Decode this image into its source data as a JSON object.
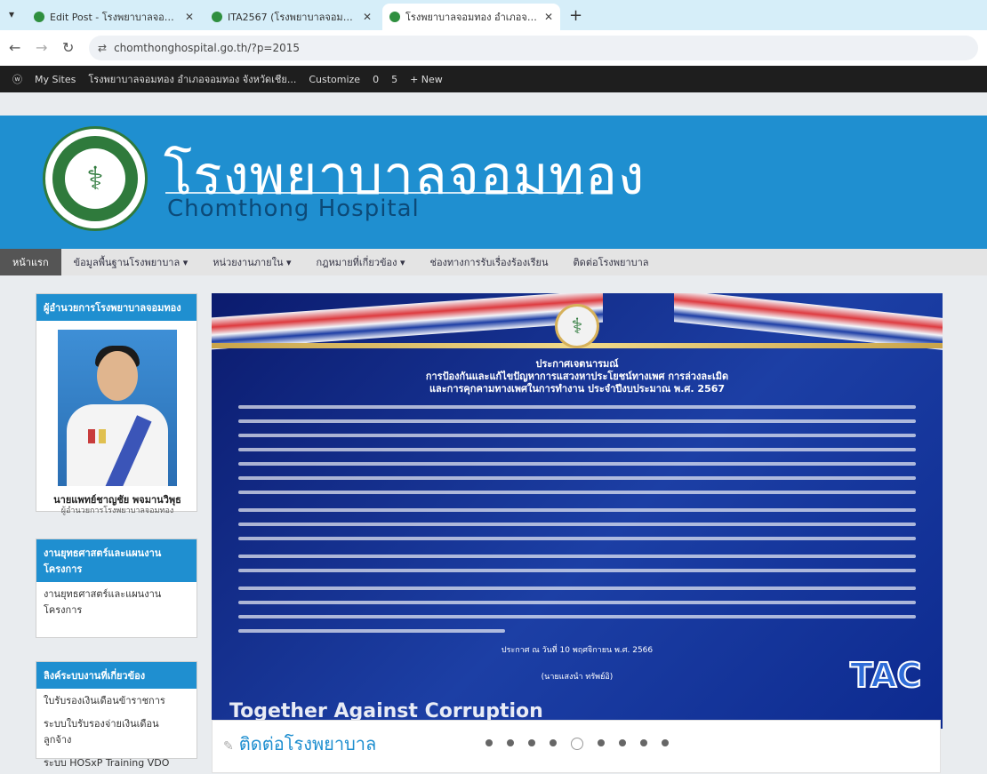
{
  "browser": {
    "tabs": [
      {
        "title": "Edit Post - โรงพยาบาลจอมทอง อำ...",
        "active": false
      },
      {
        "title": "ITA2567 (โรงพยาบาลจอมทอง อำ...",
        "active": false
      },
      {
        "title": "โรงพยาบาลจอมทอง อำเภอจอมทอง...",
        "active": true
      }
    ],
    "url": "chomthonghospital.go.th/?p=2015",
    "site_icon": "tune-icon"
  },
  "wp_admin_bar": {
    "items": [
      "My Sites",
      "โรงพยาบาลจอมทอง อำเภอจอมทอง จังหวัดเชีย...",
      "Customize",
      "0",
      "5",
      "+ New"
    ]
  },
  "header": {
    "thai_title": "โรงพยาบาลจอมทอง",
    "en_title": "Chomthong   Hospital"
  },
  "menu": {
    "items": [
      "หน้าแรก",
      "ข้อมูลพื้นฐานโรงพยาบาล ▾",
      "หน่วยงานภายใน ▾",
      "กฎหมายที่เกี่ยวข้อง ▾",
      "ช่องทางการรับเรื่องร้องเรียน",
      "ติดต่อโรงพยาบาล"
    ]
  },
  "sidebar": {
    "director": {
      "heading": "ผู้อำนวยการโรงพยาบาลจอมทอง",
      "name": "นายแพทย์ชาญชัย พจมานวิพุธ",
      "role": "ผู้อำนวยการโรงพยาบาลจอมทอง"
    },
    "plan": {
      "heading": "งานยุทธศาสตร์และแผนงานโครงการ",
      "links": [
        "งานยุทธศาสตร์และแผนงาน โครงการ"
      ]
    },
    "links_box": {
      "heading": "ลิงค์ระบบงานที่เกี่ยวข้อง",
      "links": [
        "ใบรับรองเงินเดือนข้าราชการ",
        "ระบบใบรับรองจ่ายเงินเดือน ลูกจ้าง",
        "ระบบ HOSxP Training VDO"
      ]
    }
  },
  "banner": {
    "title1": "ประกาศเจตนารมณ์",
    "title2": "การป้องกันและแก้ไขปัญหาการแสวงหาประโยชน์ทางเพศ การล่วงละเมิด",
    "title3": "และการคุกคามทางเพศในการทำงาน ประจำปีงบประมาณ พ.ศ. 2567",
    "date": "ประกาศ ณ วันที่ 10 พฤศจิกายน พ.ศ. 2566",
    "signer": "(นายแสงนำ ทรัพย์อิ)",
    "slogan": "Together Against Corruption",
    "tac": "TAC"
  },
  "carousel": {
    "count": 9,
    "active_index": 4
  },
  "contact": {
    "title": "ติดต่อโรงพยาบาล"
  }
}
